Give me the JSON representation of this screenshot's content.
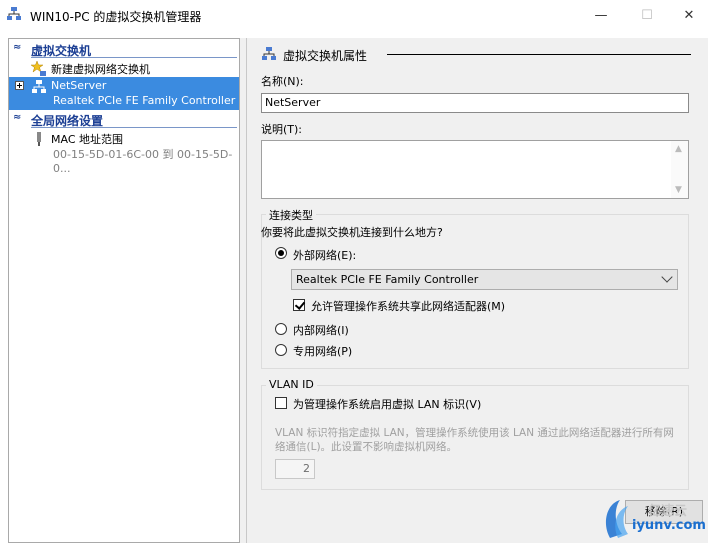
{
  "window": {
    "title": "WIN10-PC 的虚拟交换机管理器",
    "minimize_glyph": "—",
    "maximize_glyph": "☐",
    "close_glyph": "✕"
  },
  "left_pane": {
    "section1": {
      "label": "虚拟交换机",
      "chevron": "≈"
    },
    "new_switch": {
      "label": "新建虚拟网络交换机",
      "icon": "star-network-icon"
    },
    "netserver": {
      "name": "NetServer",
      "adapter": "Realtek PCIe FE Family Controller",
      "icon": "network-switch-icon"
    },
    "section2": {
      "label": "全局网络设置",
      "chevron": "≈"
    },
    "mac_range": {
      "label": "MAC 地址范围",
      "value": "00-15-5D-01-6C-00 到 00-15-5D-0...",
      "icon": "plug-icon"
    }
  },
  "right_pane": {
    "header": "虚拟交换机属性",
    "name_label": "名称(N):",
    "name_value": "NetServer",
    "desc_label": "说明(T):",
    "desc_value": "",
    "conn_group_title": "连接类型",
    "conn_question": "你要将此虚拟交换机连接到什么地方?",
    "external_label": "外部网络(E):",
    "adapter_selected": "Realtek PCIe FE Family Controller",
    "allow_share_label": "允许管理操作系统共享此网络适配器(M)",
    "internal_label": "内部网络(I)",
    "private_label": "专用网络(P)",
    "vlan_group_title": "VLAN ID",
    "vlan_enable_label": "为管理操作系统启用虚拟 LAN 标识(V)",
    "vlan_desc": "VLAN 标识符指定虚拟 LAN，管理操作系统使用该 LAN 通过此网络适配器进行所有网络通信(L)。此设置不影响虚拟机网络。",
    "vlan_value": "2",
    "remove_button": "移除(R)"
  },
  "watermark": {
    "line1": "亿速云",
    "line2": "iyunv.com"
  },
  "state": {
    "selected_connection": "external",
    "allow_share_checked": true,
    "vlan_enabled": false
  },
  "colors": {
    "selection": "#3b8be0",
    "section_header": "#1c3f94",
    "pane_bg": "#f0f0f0"
  }
}
